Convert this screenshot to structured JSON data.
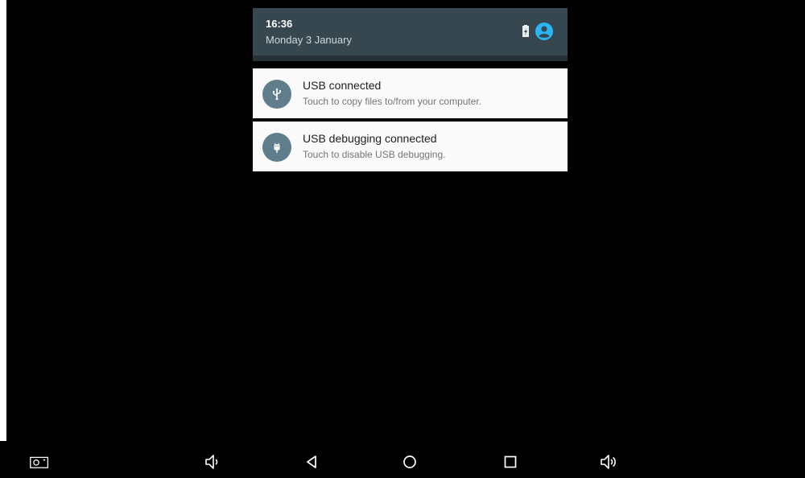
{
  "status": {
    "time": "16:36",
    "date": "Monday 3 January"
  },
  "notifications": [
    {
      "title": "USB connected",
      "text": "Touch to copy files to/from your computer.",
      "icon": "usb-icon"
    },
    {
      "title": "USB debugging connected",
      "text": "Touch to disable USB debugging.",
      "icon": "android-debug-icon"
    }
  ],
  "navbar": {
    "buttons": [
      "screenshot-icon",
      "volume-down-icon",
      "back-icon",
      "home-icon",
      "recents-icon",
      "volume-up-icon"
    ]
  },
  "colors": {
    "shade_bg": "#37474f",
    "notification_icon_bg": "#607d8b",
    "accent": "#29b6f6",
    "card_bg": "#fafafa"
  }
}
